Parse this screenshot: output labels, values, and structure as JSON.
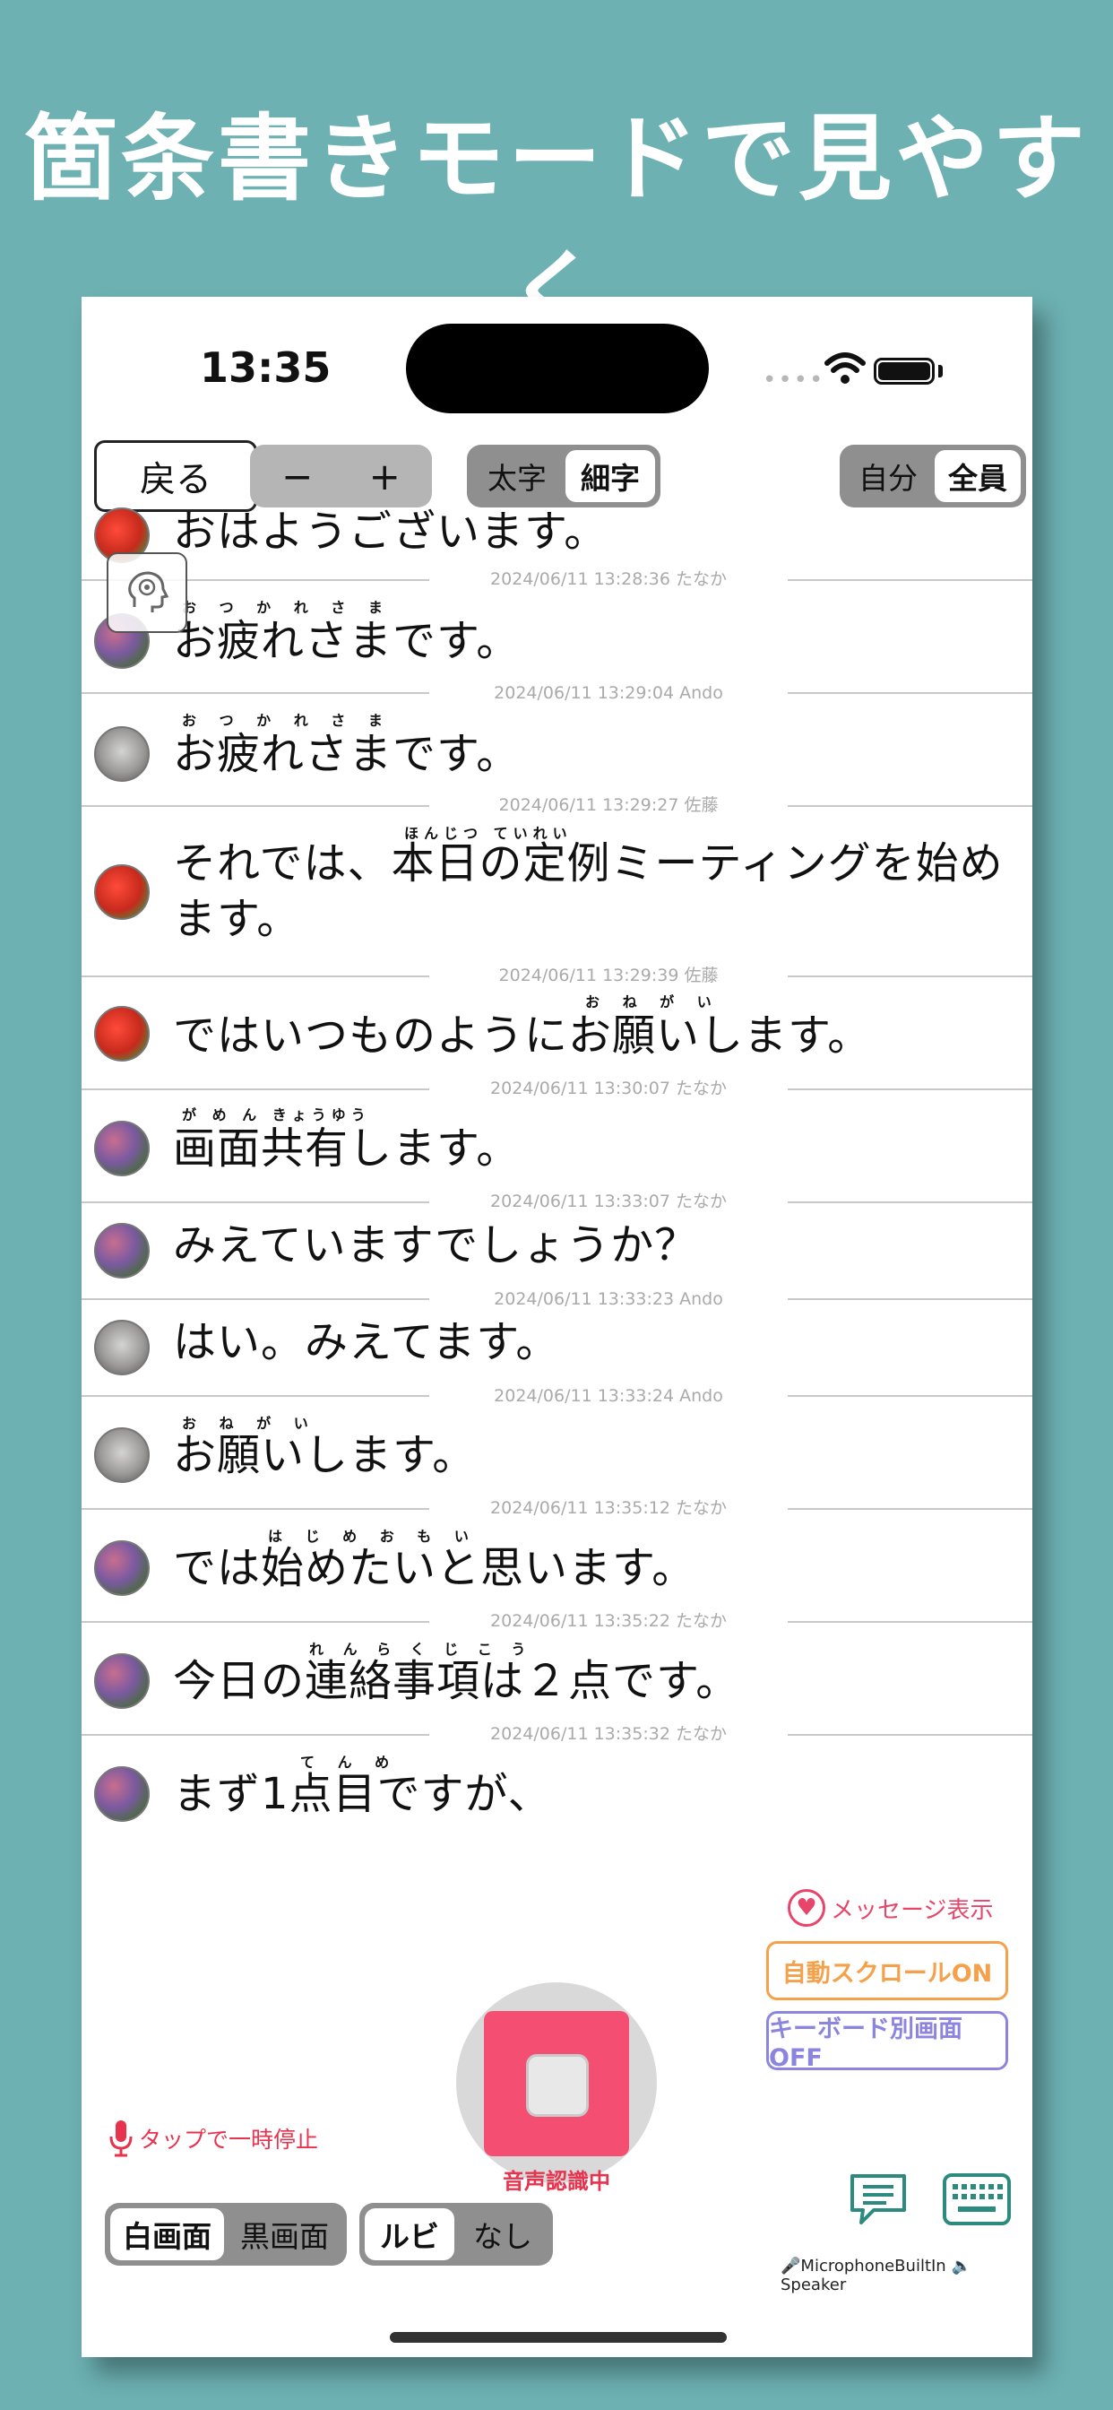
{
  "headline": "箇条書きモードで見やすく",
  "status_bar": {
    "time": "13:35",
    "signal": "••••"
  },
  "toolbar": {
    "back_label": "戻る",
    "font_minus": "−",
    "font_plus": "+",
    "weight_bold": "太字",
    "weight_thin": "細字",
    "who_me": "自分",
    "who_all": "全員"
  },
  "messages": [
    {
      "text": "おはようございます。",
      "ruby": "",
      "meta": "2024/06/11 13:28:36 たなか",
      "avatar": "strawberry"
    },
    {
      "text": "お疲れさまです。",
      "ruby": "お つ か れ さ ま",
      "meta": "2024/06/11 13:29:04 Ando",
      "avatar": "hydrangea"
    },
    {
      "text": "お疲れさまです。",
      "ruby": "お つ か れ さ ま",
      "meta": "2024/06/11 13:29:27 佐藤",
      "avatar": "statue"
    },
    {
      "text": "それでは、本日の定例ミーティングを始めます。",
      "ruby": "ほんじつ    ていれい",
      "meta": "2024/06/11 13:29:39 佐藤",
      "avatar": "strawberry"
    },
    {
      "text": "ではいつものようにお願いします。",
      "ruby": "お ね が い",
      "meta": "2024/06/11 13:30:07 たなか",
      "avatar": "strawberry"
    },
    {
      "text": "画面共有します。",
      "ruby": "が め ん きょうゆう",
      "meta": "2024/06/11 13:33:07 たなか",
      "avatar": "hydrangea"
    },
    {
      "text": "みえていますでしょうか？",
      "ruby": "",
      "meta": "2024/06/11 13:33:23 Ando",
      "avatar": "hydrangea"
    },
    {
      "text": "はい。みえてます。",
      "ruby": "",
      "meta": "2024/06/11 13:33:24 Ando",
      "avatar": "statue"
    },
    {
      "text": "お願いします。",
      "ruby": "お ね が い",
      "meta": "2024/06/11 13:35:12 たなか",
      "avatar": "statue"
    },
    {
      "text": "では始めたいと思います。",
      "ruby": "は じ め     お も い",
      "meta": "2024/06/11 13:35:22 たなか",
      "avatar": "hydrangea"
    },
    {
      "text": "今日の連絡事項は２点です。",
      "ruby": "れ ん ら く じ こ う",
      "meta": "2024/06/11 13:35:32 たなか",
      "avatar": "hydrangea"
    },
    {
      "text": "まず1点目ですが、",
      "ruby": "て ん め",
      "meta": "",
      "avatar": "hydrangea"
    }
  ],
  "controls": {
    "message_display": "メッセージ表示",
    "autoscroll": "自動スクロールON",
    "keyboard_screen": "キーボード別画面OFF",
    "recording_status": "音声認識中",
    "pause_hint": "タップで一時停止",
    "screen_white": "白画面",
    "screen_black": "黒画面",
    "ruby_on": "ルビ",
    "ruby_off": "なし",
    "audio_route": "🎤MicrophoneBuiltIn 🔈Speaker"
  },
  "colors": {
    "background": "#6db1b3",
    "record": "#f44f72",
    "accent_red": "#e8334e",
    "autoscroll": "#f5a04a",
    "keyboard": "#8b85e0",
    "chat_icon": "#2c8a7e"
  }
}
